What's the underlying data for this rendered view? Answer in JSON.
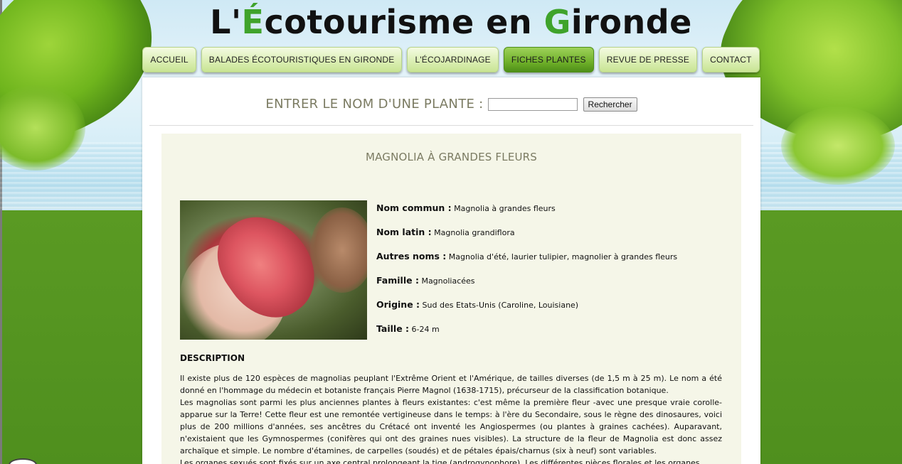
{
  "site": {
    "title_prefix": "L'",
    "title_e": "É",
    "title_mid": "cotourisme en ",
    "title_g": "G",
    "title_end": "ironde"
  },
  "nav": [
    {
      "label": "ACCUEIL",
      "active": false
    },
    {
      "label": "BALADES ÉCOTOURISTIQUES EN GIRONDE",
      "active": false
    },
    {
      "label": "L'ÉCOJARDINAGE",
      "active": false
    },
    {
      "label": "FICHES PLANTES",
      "active": true
    },
    {
      "label": "REVUE DE PRESSE",
      "active": false
    },
    {
      "label": "CONTACT",
      "active": false
    }
  ],
  "search": {
    "label": "ENTRER LE NOM D'UNE PLANTE :",
    "value": "",
    "button": "Rechercher"
  },
  "plant": {
    "title": "MAGNOLIA À GRANDES FLEURS",
    "facts": [
      {
        "key": "Nom commun :",
        "value": "Magnolia à grandes fleurs"
      },
      {
        "key": "Nom latin :",
        "value": "Magnolia grandiflora"
      },
      {
        "key": "Autres noms :",
        "value": "Magnolia d'été, laurier tulipier, magnolier à grandes fleurs"
      },
      {
        "key": "Famille :",
        "value": "Magnoliacées"
      },
      {
        "key": "Origine :",
        "value": "Sud des Etats-Unis (Caroline, Louisiane)"
      },
      {
        "key": "Taille :",
        "value": "6-24 m"
      }
    ],
    "description_title": "DESCRIPTION",
    "description": [
      "Il existe plus de 120 espèces de magnolias peuplant l'Extrême Orient et l'Amérique, de tailles diverses (de 1,5 m à 25 m). Le nom a été donné en l'hommage du médecin et botaniste français Pierre Magnol (1638-1715), précurseur de la classification botanique.",
      "Les magnolias sont parmi les plus anciennes plantes à fleurs existantes: c'est même la première fleur -avec une presque vraie corolle- apparue sur la Terre! Cette fleur est une remontée vertigineuse dans le temps: à l'ère du Secondaire, sous le règne des dinosaures, voici plus de 200 millions d'années, ses ancêtres du Crétacé ont inventé les Angiospermes (ou plantes à graines cachées). Auparavant, n'existaient que les Gymnospermes (conifères qui ont des graines nues visibles). La structure de la fleur de Magnolia est donc assez archaïque et simple. Le nombre d'étamines, de carpelles (soudés) et de pétales épais/charnus (six à neuf) sont variables.",
      "Les organes sexués sont fixés sur un axe central prolongeant la tige (androgynophore). Les différentes pièces florales et les organes"
    ]
  }
}
